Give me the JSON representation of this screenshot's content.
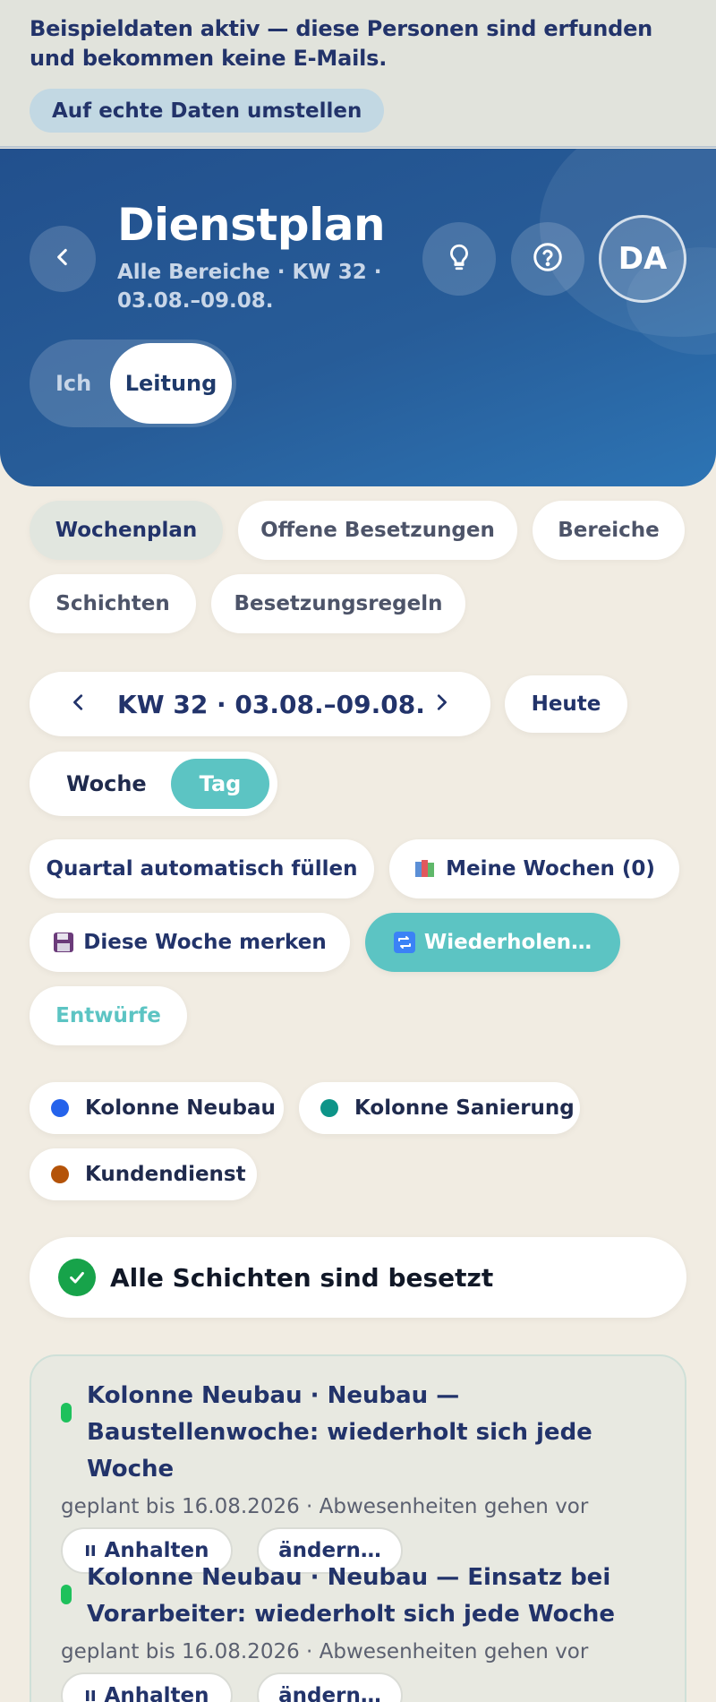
{
  "demo_banner": {
    "text": "Beispieldaten aktiv — diese Personen sind erfunden und bekommen keine E-Mails.",
    "button": "Auf echte Daten umstellen"
  },
  "header": {
    "title": "Dienstplan",
    "subtitle": "Alle Bereiche · KW 32 · 03.08.–09.08.",
    "avatar_initials": "DA",
    "role_toggle": {
      "options": [
        "Ich",
        "Leitung"
      ],
      "selected": "Leitung"
    }
  },
  "tabs": [
    {
      "label": "Wochenplan",
      "active": true
    },
    {
      "label": "Offene Besetzungen",
      "active": false
    },
    {
      "label": "Bereiche",
      "active": false
    },
    {
      "label": "Schichten",
      "active": false
    },
    {
      "label": "Besetzungsregeln",
      "active": false
    }
  ],
  "week_nav": {
    "label": "KW 32 · 03.08.–09.08.",
    "today": "Heute"
  },
  "view_toggle": {
    "options": [
      "Woche",
      "Tag"
    ],
    "selected": "Tag"
  },
  "actions": {
    "fill_quarter": "Quartal automatisch füllen",
    "my_weeks": "Meine Wochen (0)",
    "save_week": "Diese Woche merken",
    "repeat": "Wiederholen…",
    "drafts": "Entwürfe"
  },
  "legend": [
    {
      "label": "Kolonne Neubau",
      "color": "#2563eb"
    },
    {
      "label": "Kolonne Sanierung",
      "color": "#0d9488"
    },
    {
      "label": "Kundendienst",
      "color": "#b45309"
    }
  ],
  "status": {
    "text": "Alle Schichten sind besetzt",
    "color": "#17a34a"
  },
  "recurring": [
    {
      "title": "Kolonne Neubau · Neubau — Baustellenwoche: wiederholt sich jede Woche",
      "meta": "geplant bis 16.08.2026 · Abwesenheiten gehen vor",
      "pause": "Anhalten",
      "edit": "ändern…"
    },
    {
      "title": "Kolonne Neubau · Neubau — Einsatz bei Vorarbeiter: wiederholt sich jede Woche",
      "meta": "geplant bis 16.08.2026 · Abwesenheiten gehen vor",
      "pause": "Anhalten",
      "edit": "ändern…"
    }
  ]
}
